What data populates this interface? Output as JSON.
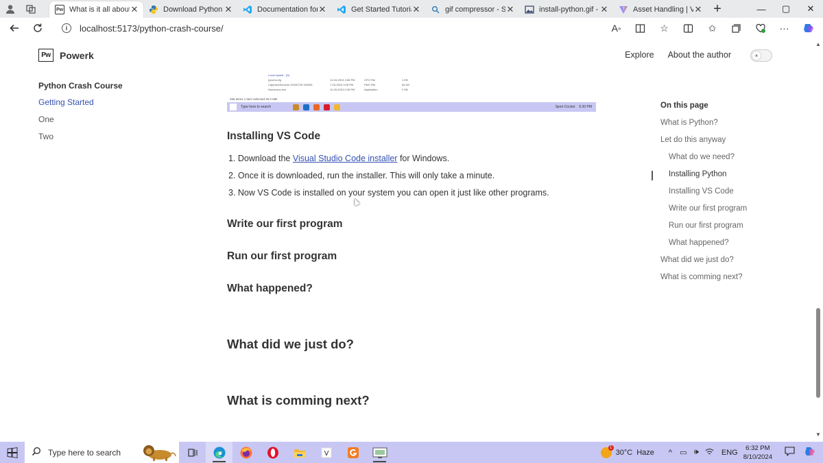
{
  "browser": {
    "tabs": [
      {
        "title": "What is it all about?",
        "active": true,
        "favicon": "powerk-icon"
      },
      {
        "title": "Download Python | P",
        "active": false,
        "favicon": "python-icon"
      },
      {
        "title": "Documentation for V",
        "active": false,
        "favicon": "vscode-icon"
      },
      {
        "title": "Get Started Tutorial",
        "active": false,
        "favicon": "vscode-icon"
      },
      {
        "title": "gif compressor - Sea",
        "active": false,
        "favicon": "search-icon"
      },
      {
        "title": "install-python.gif - A",
        "active": false,
        "favicon": "image-icon"
      },
      {
        "title": "Asset Handling | Vite",
        "active": false,
        "favicon": "vite-icon"
      }
    ],
    "url": "localhost:5173/python-crash-course/"
  },
  "site": {
    "logo_mark": "Pw",
    "logo_name": "Powerk",
    "nav": [
      "Explore",
      "About the author"
    ]
  },
  "sidebar": {
    "group": "Python Crash Course",
    "items": [
      {
        "label": "Getting Started",
        "active": true
      },
      {
        "label": "One",
        "active": false
      },
      {
        "label": "Two",
        "active": false
      }
    ]
  },
  "embedded_gif": {
    "rows": [
      {
        "name": "Local myself - (D)",
        "date": "",
        "type": "",
        "size": ""
      },
      {
        "name": "pyvenv.cfg",
        "date": "12-04-2024 4:56 PM",
        "type": "CFG File",
        "size": "1 KB"
      },
      {
        "name": "CapturedScreens 20240735 155206",
        "date": "7-25-2024 3:26 PM",
        "type": "PNG File",
        "size": "84 KB"
      },
      {
        "name": "Numerous.exe",
        "date": "11-09-2024 2:06 PM",
        "type": "Application",
        "size": "2 KB"
      }
    ],
    "footer": "256 items    1 item selected  25.2 MB",
    "taskbar_search": "Type here to search",
    "taskbar_weather": "Sport Cricket",
    "taskbar_clock": "6:30 PM"
  },
  "article": {
    "installing_vscode": "Installing VS Code",
    "steps": {
      "s1_prefix": "Download the ",
      "s1_link": "Visual Studio Code installer",
      "s1_suffix": " for Windows.",
      "s2": "Once it is downloaded, run the installer. This will only take a minute.",
      "s3": "Now VS Code is installed on your system you can open it just like other programs."
    },
    "write_program": "Write our first program",
    "run_program": "Run our first program",
    "what_happened": "What happened?",
    "what_did_we_do": "What did we just do?",
    "whats_next": "What is comming next?"
  },
  "outline": {
    "title": "On this page",
    "items": [
      {
        "label": "What is Python?",
        "level": 1,
        "active": false
      },
      {
        "label": "Let do this anyway",
        "level": 1,
        "active": false
      },
      {
        "label": "What do we need?",
        "level": 2,
        "active": false
      },
      {
        "label": "Installing Python",
        "level": 2,
        "active": true
      },
      {
        "label": "Installing VS Code",
        "level": 2,
        "active": false
      },
      {
        "label": "Write our first program",
        "level": 2,
        "active": false
      },
      {
        "label": "Run our first program",
        "level": 2,
        "active": false
      },
      {
        "label": "What happened?",
        "level": 2,
        "active": false
      },
      {
        "label": "What did we just do?",
        "level": 1,
        "active": false
      },
      {
        "label": "What is comming next?",
        "level": 1,
        "active": false
      }
    ]
  },
  "taskbar": {
    "search_placeholder": "Type here to search",
    "weather_temp": "30°C",
    "weather_desc": "Haze",
    "weather_badge": "1",
    "language": "ENG",
    "time": "6:32 PM",
    "date": "8/10/2024",
    "apps": [
      "task-view-icon",
      "edge-icon",
      "firefox-icon",
      "opera-icon",
      "file-explorer-icon",
      "vim-icon",
      "gif-app-icon",
      "screen-tool-icon"
    ]
  },
  "colors": {
    "accent_link": "#3451b2",
    "taskbar_bg": "#c8c7f3"
  }
}
